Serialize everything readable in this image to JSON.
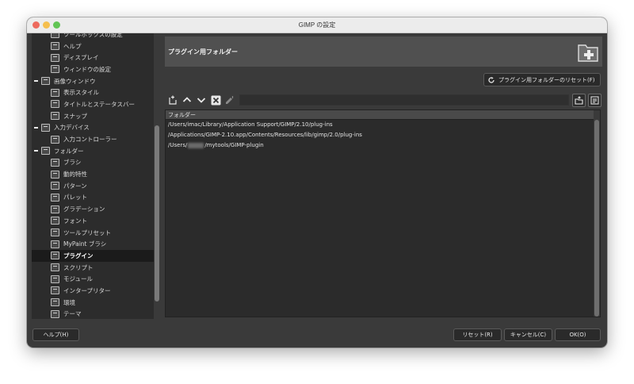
{
  "window": {
    "title": "GIMP の設定"
  },
  "sidebar": {
    "items": [
      {
        "label": "ツールボックスの設定",
        "level": 2,
        "icon": "toolbox-icon"
      },
      {
        "label": "ヘルプ",
        "level": 2,
        "icon": "help-icon"
      },
      {
        "label": "ディスプレイ",
        "level": 2,
        "icon": "display-icon"
      },
      {
        "label": "ウィンドウの設定",
        "level": 2,
        "icon": "window-management-icon"
      },
      {
        "label": "画像ウィンドウ",
        "level": 1,
        "icon": "image-window-icon"
      },
      {
        "label": "表示スタイル",
        "level": 2,
        "icon": "appearance-icon"
      },
      {
        "label": "タイトルとステータスバー",
        "level": 2,
        "icon": "title-status-icon"
      },
      {
        "label": "スナップ",
        "level": 2,
        "icon": "snap-icon"
      },
      {
        "label": "入力デバイス",
        "level": 1,
        "icon": "input-device-icon"
      },
      {
        "label": "入力コントローラー",
        "level": 2,
        "icon": "input-controller-icon"
      },
      {
        "label": "フォルダー",
        "level": 1,
        "icon": "folder-icon"
      },
      {
        "label": "ブラシ",
        "level": 2,
        "icon": "brush-folder-icon"
      },
      {
        "label": "動的特性",
        "level": 2,
        "icon": "dynamics-folder-icon"
      },
      {
        "label": "パターン",
        "level": 2,
        "icon": "pattern-folder-icon"
      },
      {
        "label": "パレット",
        "level": 2,
        "icon": "palette-folder-icon"
      },
      {
        "label": "グラデーション",
        "level": 2,
        "icon": "gradient-folder-icon"
      },
      {
        "label": "フォント",
        "level": 2,
        "icon": "font-folder-icon"
      },
      {
        "label": "ツールプリセット",
        "level": 2,
        "icon": "tool-preset-folder-icon"
      },
      {
        "label": "MyPaint ブラシ",
        "level": 2,
        "icon": "mypaint-folder-icon"
      },
      {
        "label": "プラグイン",
        "level": 2,
        "icon": "plugin-folder-icon",
        "selected": true
      },
      {
        "label": "スクリプト",
        "level": 2,
        "icon": "script-folder-icon"
      },
      {
        "label": "モジュール",
        "level": 2,
        "icon": "module-folder-icon"
      },
      {
        "label": "インタープリター",
        "level": 2,
        "icon": "interpreter-folder-icon"
      },
      {
        "label": "環境",
        "level": 2,
        "icon": "environment-folder-icon"
      },
      {
        "label": "テーマ",
        "level": 2,
        "icon": "theme-folder-icon"
      }
    ]
  },
  "main": {
    "header_title": "プラグイン用フォルダー",
    "reset_folders_label": "プラグイン用フォルダーのリセット(F)",
    "list_header": "フォルダー",
    "folders": [
      "/Users/imac/Library/Application Support/GIMP/2.10/plug-ins",
      "/Applications/GIMP-2.10.app/Contents/Resources/lib/gimp/2.0/plug-ins"
    ],
    "folder3_prefix": "/Users/",
    "folder3_suffix": "/mytools/GIMP-plugin"
  },
  "footer": {
    "help_label": "ヘルプ(H)",
    "reset_label": "リセット(R)",
    "cancel_label": "キャンセル(C)",
    "ok_label": "OK(O)"
  },
  "colors": {
    "window_bg": "#3a3a3a",
    "sidebar_bg": "#2c2c2c",
    "header_band": "#505050",
    "selected_row": "#1b1b1b"
  }
}
